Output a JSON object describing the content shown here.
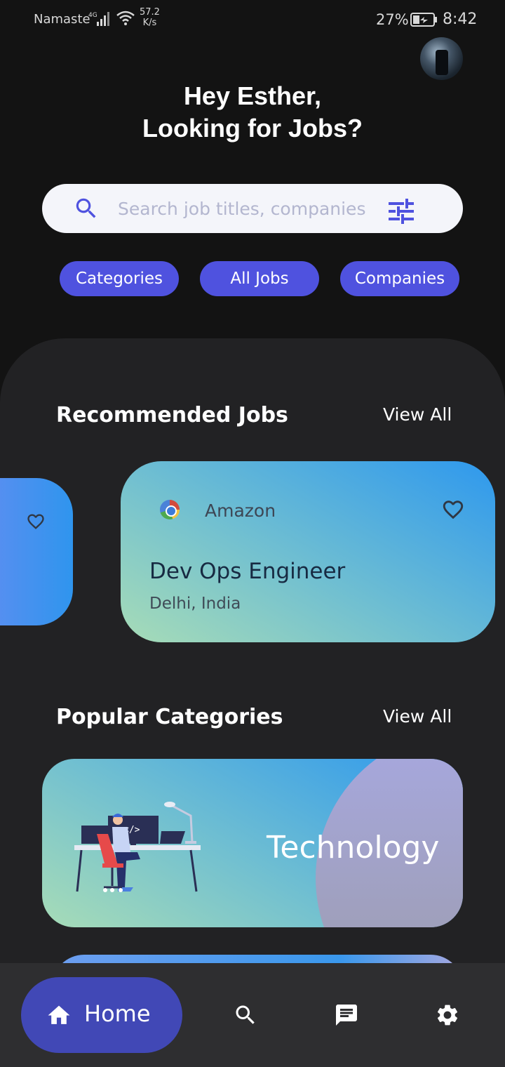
{
  "status_bar": {
    "carrier": "Namaste",
    "network": "4G",
    "speed_value": "57.2",
    "speed_unit": "K/s",
    "battery": "27%",
    "time": "8:42"
  },
  "header": {
    "greeting_line1": "Hey Esther,",
    "greeting_line2": "Looking for Jobs?"
  },
  "search": {
    "placeholder": "Search job titles, companies",
    "value": ""
  },
  "filters": [
    {
      "label": "Categories"
    },
    {
      "label": "All Jobs"
    },
    {
      "label": "Companies"
    }
  ],
  "recommended": {
    "title": "Recommended Jobs",
    "view_all": "View All",
    "jobs": [
      {
        "company": "Amazon",
        "title": "Dev Ops Engineer",
        "location": "Delhi, India"
      }
    ]
  },
  "popular": {
    "title": "Popular Categories",
    "view_all": "View All",
    "categories": [
      {
        "label": "Technology"
      }
    ]
  },
  "bottom_nav": {
    "home_label": "Home"
  },
  "colors": {
    "accent": "#4f52df",
    "nav_active": "#4148b6",
    "background": "#131313",
    "panel": "#222224"
  },
  "icons": [
    "search-icon",
    "filter-icon",
    "heart-icon",
    "home-icon",
    "chat-icon",
    "gear-icon"
  ]
}
